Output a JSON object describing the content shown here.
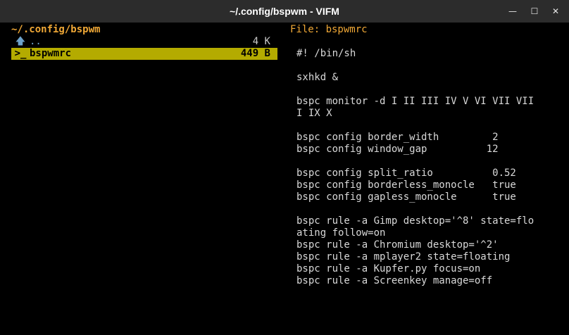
{
  "window": {
    "title": "~/.config/bspwm - VIFM",
    "min_label": "—",
    "max_label": "☐",
    "close_label": "✕"
  },
  "left_pane": {
    "path": "~/.config/bspwm",
    "entries": [
      {
        "icon": "🡅",
        "name": "..",
        "size": "4 K"
      },
      {
        "icon": ">_",
        "name": "bspwmrc",
        "size": "449 B"
      }
    ]
  },
  "right_pane": {
    "header": "File: bspwmrc",
    "lines": [
      "#! /bin/sh",
      "",
      "sxhkd &",
      "",
      "bspc monitor -d I II III IV V VI VII VII",
      "I IX X",
      "",
      "bspc config border_width         2",
      "bspc config window_gap          12",
      "",
      "bspc config split_ratio          0.52",
      "bspc config borderless_monocle   true",
      "bspc config gapless_monocle      true",
      "",
      "bspc rule -a Gimp desktop='^8' state=flo",
      "ating follow=on",
      "bspc rule -a Chromium desktop='^2'",
      "bspc rule -a mplayer2 state=floating",
      "bspc rule -a Kupfer.py focus=on",
      "bspc rule -a Screenkey manage=off"
    ]
  },
  "colors": {
    "titlebar": "#2c2c2c",
    "background": "#000000",
    "path_accent": "#f0a836",
    "selection": "#b4ab00",
    "dir_color": "#6ea3cc",
    "text": "#d9d9d9"
  }
}
